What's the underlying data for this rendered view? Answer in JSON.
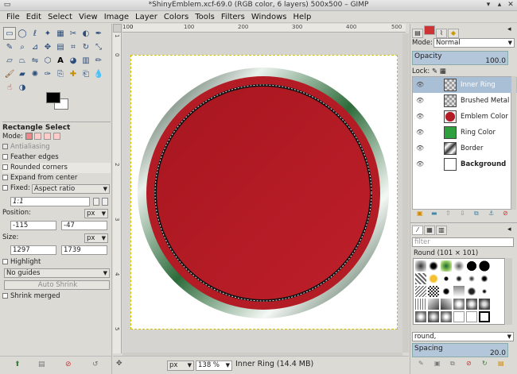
{
  "window": {
    "title": "*ShinyEmblem.xcf-69.0 (RGB color, 6 layers) 500x500 – GIMP"
  },
  "menu": [
    "File",
    "Edit",
    "Select",
    "View",
    "Image",
    "Layer",
    "Colors",
    "Tools",
    "Filters",
    "Windows",
    "Help"
  ],
  "tool_options": {
    "title": "Rectangle Select",
    "mode_label": "Mode:",
    "antialiasing": "Antialiasing",
    "feather_edges": "Feather edges",
    "rounded_corners": "Rounded corners",
    "expand_from_center": "Expand from center",
    "fixed_label": "Fixed:",
    "fixed_value": "Aspect ratio",
    "ratio_value": "1:1",
    "position_label": "Position:",
    "position_unit": "px",
    "position_x": "-115",
    "position_y": "-47",
    "size_label": "Size:",
    "size_unit": "px",
    "size_w": "1297",
    "size_h": "1739",
    "highlight": "Highlight",
    "guides_value": "No guides",
    "auto_shrink": "Auto Shrink",
    "shrink_merged": "Shrink merged"
  },
  "rulers": {
    "h": [
      "100",
      "0",
      "100",
      "200",
      "300",
      "400",
      "500",
      "600"
    ],
    "v": [
      "1",
      "0",
      "2",
      "3",
      "4",
      "5"
    ]
  },
  "statusbar": {
    "unit": "px",
    "zoom": "138 %",
    "message": "Inner Ring (14.4 MB)"
  },
  "layers_panel": {
    "mode_label": "Mode:",
    "mode_value": "Normal",
    "opacity_label": "Opacity",
    "opacity_value": "100.0",
    "lock_label": "Lock:",
    "layers": [
      {
        "name": "Inner Ring"
      },
      {
        "name": "Brushed Metal"
      },
      {
        "name": "Emblem Color"
      },
      {
        "name": "Ring Color"
      },
      {
        "name": "Border"
      },
      {
        "name": "Background"
      }
    ]
  },
  "brushes_panel": {
    "filter_placeholder": "filter",
    "brush_title": "Round (101 × 101)",
    "tag_value": "round,",
    "spacing_label": "Spacing",
    "spacing_value": "20.0"
  },
  "colors": {
    "emblem_red": "#b31b25",
    "ring_green": "#2d6b3a",
    "selection": "#d8d800",
    "fg": "#000000",
    "bg": "#ffffff"
  }
}
